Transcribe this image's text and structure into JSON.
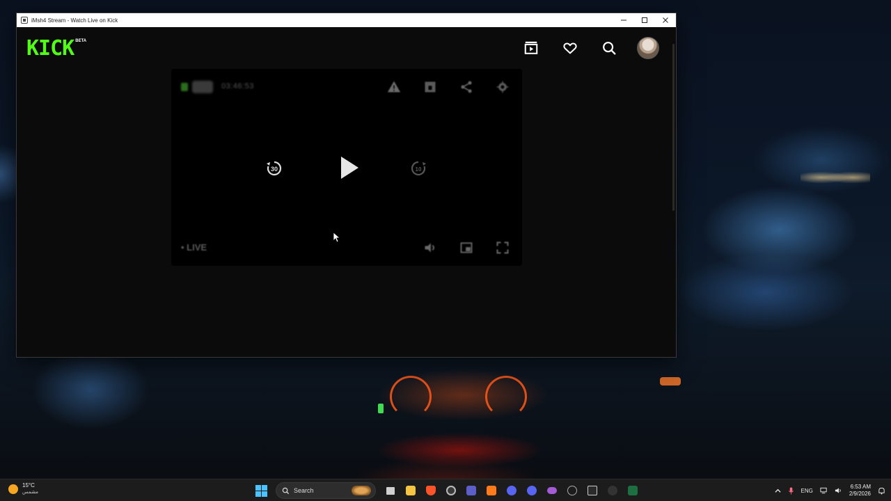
{
  "window": {
    "title": "iMsh4 Stream - Watch Live on Kick",
    "minimize_icon": "minimize-icon",
    "maximize_icon": "maximize-icon",
    "close_icon": "close-icon"
  },
  "header": {
    "logo_text": "KICK",
    "logo_badge": "BETA",
    "brand_color": "#53fc18",
    "icons": [
      "following-icon",
      "heart-icon",
      "search-icon",
      "user-avatar"
    ]
  },
  "player": {
    "uptime": "03:46:53",
    "live_label": "LIVE",
    "rewind_label": "30",
    "forward_label": "10",
    "top_icons": [
      "warning-icon",
      "clip-icon",
      "share-icon",
      "settings-icon"
    ],
    "bottom_icons": [
      "volume-icon",
      "pip-icon",
      "fullscreen-icon"
    ]
  },
  "taskbar": {
    "weather_temp": "15°C",
    "weather_condition": "مشمس",
    "search_label": "Search",
    "apps": [
      "task-view",
      "file-explorer",
      "brave",
      "chrome",
      "teams",
      "app-a",
      "discord",
      "discord-2",
      "game-controller",
      "react-app",
      "terminal",
      "app-dark",
      "excel"
    ],
    "language": "ENG",
    "time": "6:53 AM",
    "date": "2/9/2026"
  }
}
